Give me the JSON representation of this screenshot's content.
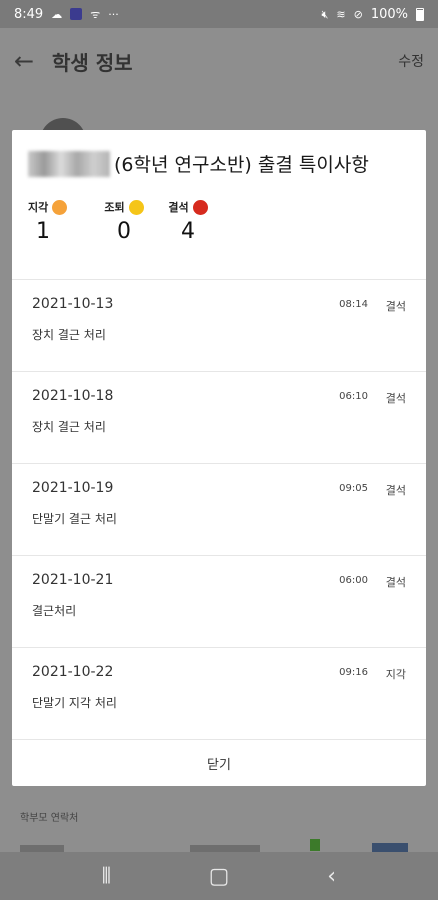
{
  "status_bar": {
    "time": "8:49",
    "battery": "100%"
  },
  "header": {
    "title": "학생 정보",
    "edit_label": "수정"
  },
  "modal": {
    "title": "(6학년 연구소반) 출결 특이사항",
    "summary": [
      {
        "label": "지각",
        "count": "1",
        "color": "#f5a23a"
      },
      {
        "label": "조퇴",
        "count": "0",
        "color": "#f5c518"
      },
      {
        "label": "결석",
        "count": "4",
        "color": "#d62a1e"
      }
    ],
    "records": [
      {
        "date": "2021-10-13",
        "time": "08:14",
        "status": "결석",
        "note": "장치 결근 처리"
      },
      {
        "date": "2021-10-18",
        "time": "06:10",
        "status": "결석",
        "note": "장치 결근 처리"
      },
      {
        "date": "2021-10-19",
        "time": "09:05",
        "status": "결석",
        "note": "단말기 결근 처리"
      },
      {
        "date": "2021-10-21",
        "time": "06:00",
        "status": "결석",
        "note": "결근처리"
      },
      {
        "date": "2021-10-22",
        "time": "09:16",
        "status": "지각",
        "note": "단말기 지각 처리"
      }
    ],
    "close_label": "닫기"
  },
  "background": {
    "contact_title": "학부모 연락처"
  }
}
